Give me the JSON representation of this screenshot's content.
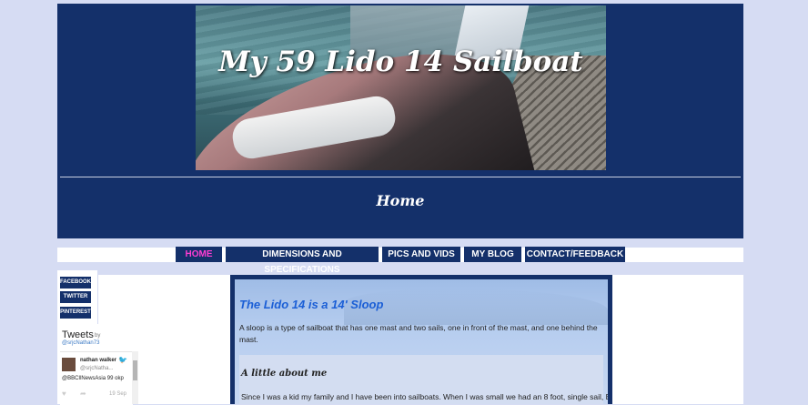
{
  "header": {
    "banner_title": "My 59 Lido 14 Sailboat",
    "page_title": "Home"
  },
  "nav": {
    "items": [
      {
        "label": "HOME",
        "active": true
      },
      {
        "label": "DIMENSIONS AND SPECIFICATIONS",
        "active": false
      },
      {
        "label": "PICS AND VIDS",
        "active": false
      },
      {
        "label": "MY BLOG",
        "active": false
      },
      {
        "label": "CONTACT/FEEDBACK",
        "active": false
      }
    ]
  },
  "social": {
    "facebook": "FACEBOOK",
    "twitter": "TWITTER",
    "pinterest": "PINTEREST"
  },
  "tweets": {
    "title": "Tweets",
    "by": "by",
    "handle": "@srjcNathan73",
    "tweet": {
      "name": "nathan walker",
      "user": "@srjcNatha...",
      "text": "@BBCIlNewsAsia 99 okp",
      "date": "19 Sep"
    }
  },
  "content": {
    "heading": "The Lido 14 is a 14' Sloop",
    "paragraph": "A sloop is a type of sailboat that has one mast and two sails, one in front of the mast, and one behind the mast.",
    "about_heading": "A little about me",
    "about_text": "Since I was a kid my family and I have been into sailboats. When I was small we had an 8 foot, single sail, El"
  },
  "colors": {
    "navy": "#14306a",
    "background": "#d6dcf3",
    "nav_active": "#ff3dd3",
    "heading_blue": "#1b5fd6"
  }
}
